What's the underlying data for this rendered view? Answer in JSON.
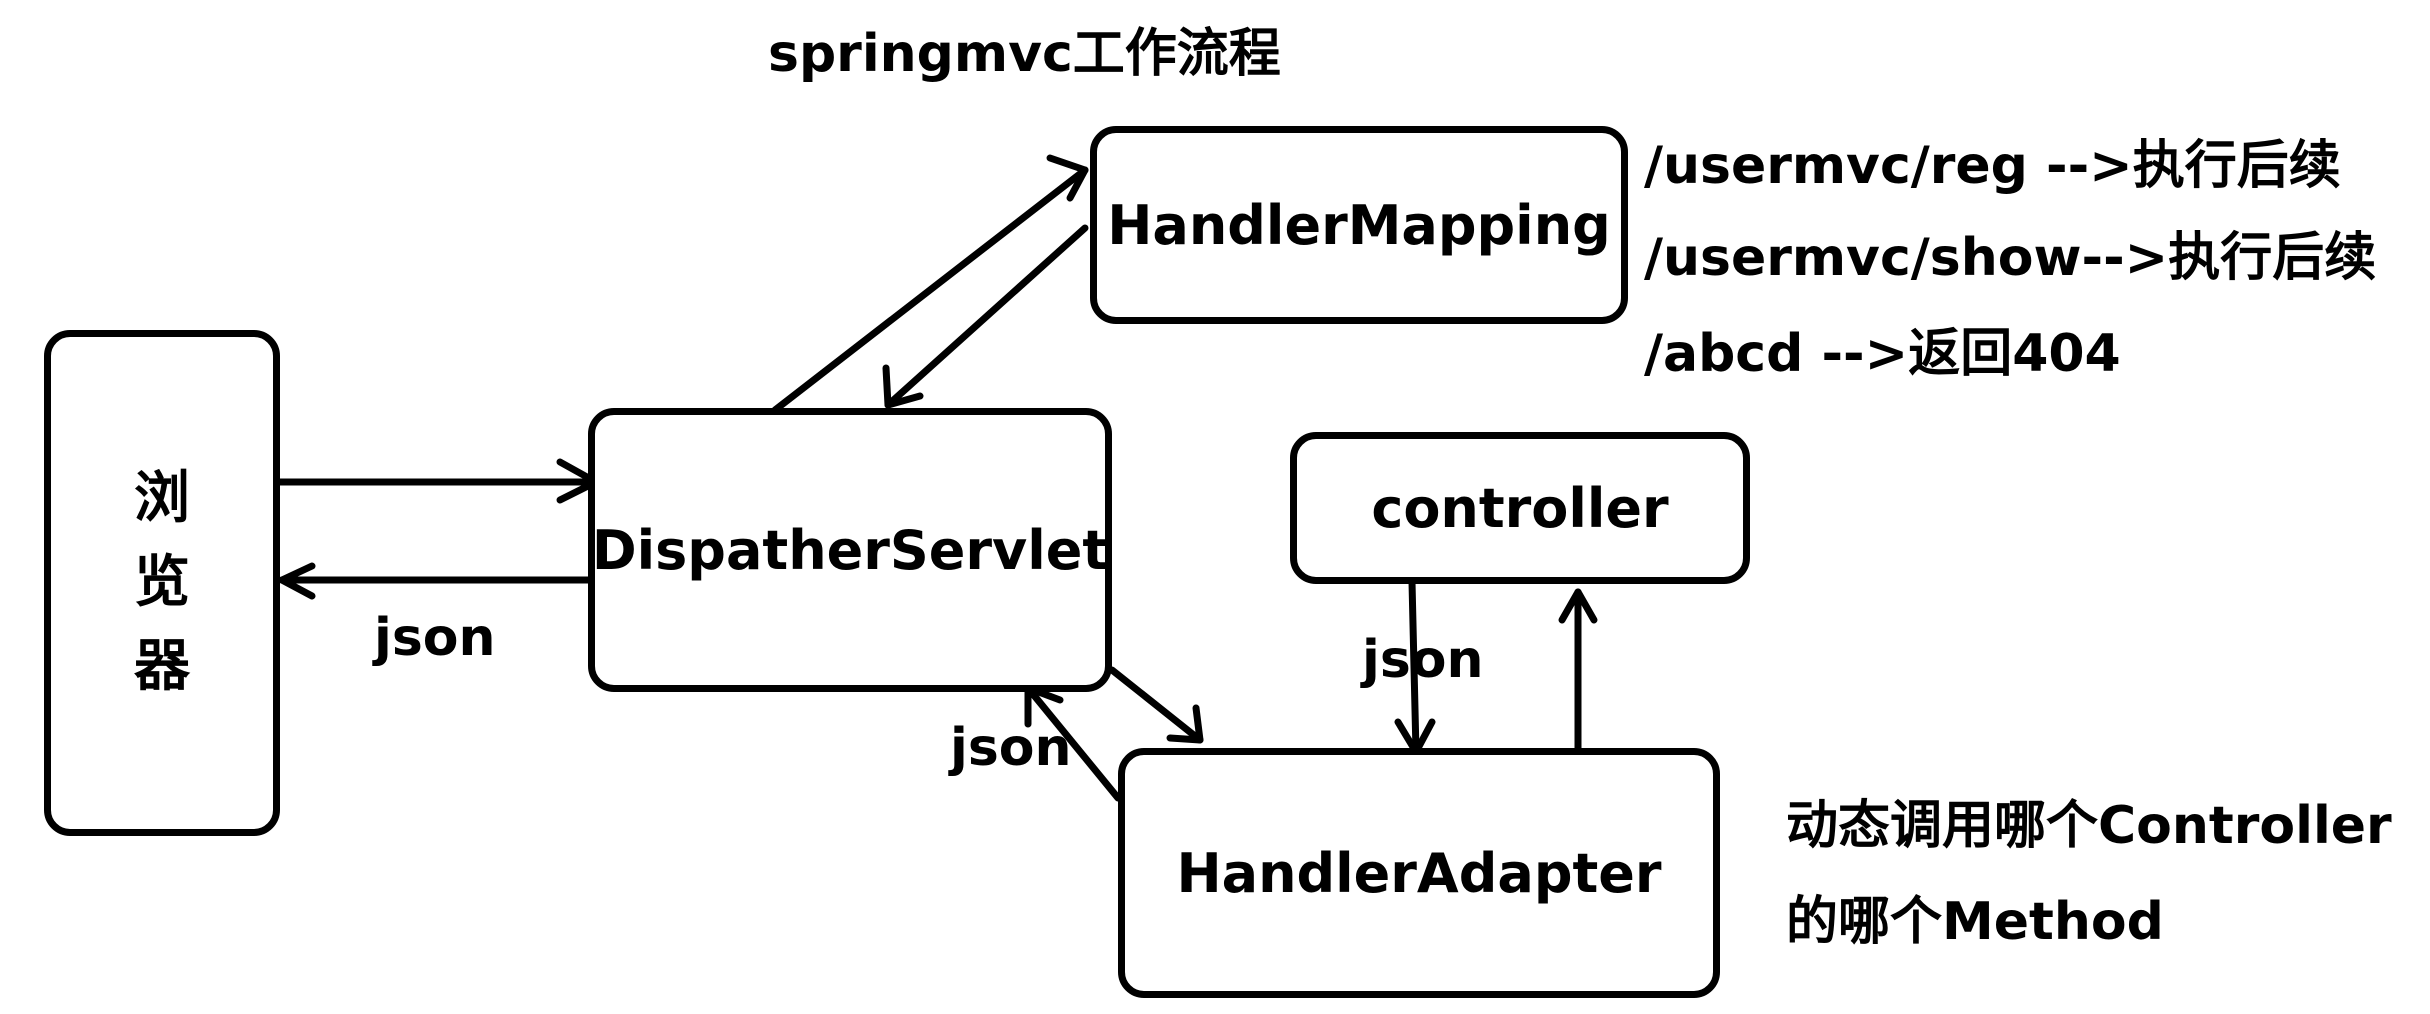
{
  "title": "springmvc工作流程",
  "nodes": {
    "browser": [
      "浏",
      "览",
      "器"
    ],
    "dispatcher": "DispatherServlet",
    "handler_mapping": "HandlerMapping",
    "controller": "controller",
    "handler_adapter": "HandlerAdapter"
  },
  "edge_labels": {
    "browser_return": "json",
    "adapter_to_dispatcher": "json",
    "controller_to_adapter": "json"
  },
  "routes": [
    "/usermvc/reg -->执行后续",
    "/usermvc/show-->执行后续",
    "/abcd -->返回404"
  ],
  "note": [
    "动态调用哪个Controller",
    "的哪个Method"
  ]
}
